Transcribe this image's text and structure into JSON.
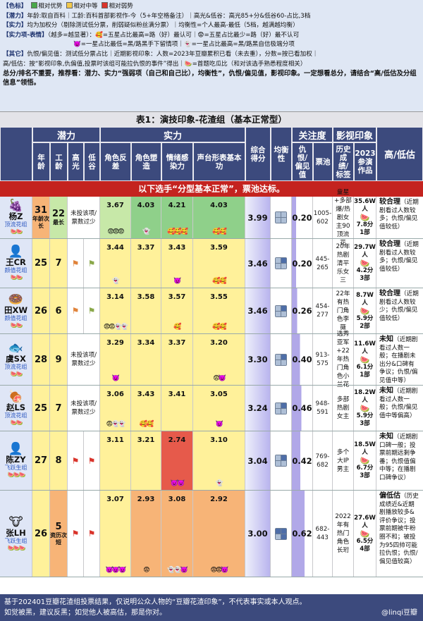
{
  "notes": {
    "line1": {
      "k": "【色标】",
      "good": "相对优势",
      "mid": "相对中等",
      "weak": "相对弱势",
      "c_good": "#4aa84a",
      "c_mid": "#f2c94c",
      "c_weak": "#d9342b"
    },
    "line2": {
      "k": "【潜力】",
      "t": "年龄:取自百科｜工龄:百科首部影视作-今（5+年空格备注）｜高光&低谷：高光85+分&低谷60-占比,3档"
    },
    "line3": {
      "k": "【实力】",
      "t": "均为加权分（剔除测试低分票，削弱疑似粉丝满分票）｜均衡性=个人最高-最低（5档，越满越均衡）"
    },
    "line4": {
      "k": "【实力项-表情】",
      "t": "（越多=越显著）：🥰=五星占比最高=路（好）最认可｜😨=五星占比最少=路（好）最不认可"
    },
    "line5": {
      "t": "👿=一星占比最低=黑/路黑手下留情项｜👻=一星占比最高=黑/路黑自信极端分项"
    },
    "line6": {
      "k": "【其它】",
      "t": "仇恨/偏见值：测试低分票占比｜近期影视印象：人数=2023年豆瓣累积已看（未去重），分数=按已看加权｜"
    },
    "line7": {
      "t": "高/低估：按“影视印象,仇偏值,投票时该组可能拉仇恨的事件”得出｜🍉=首题吃瓜比（和对该选手熟悉程度相关）"
    },
    "line8": {
      "t": "总分/排名不重要，推荐看：潜力、实力“强弱项（自己和自己比），均衡性”，仇恨/偏见值，影视印象。一定想看总分，请结合“高/低估及分组信息”领悟。"
    }
  },
  "table": {
    "title": "表1：演技印象-花渣组（基本正常型）",
    "groups": {
      "potential": "潜力",
      "strength": "实力",
      "attention": "关注度",
      "impression": "影视印象",
      "estimate": "高/低估"
    },
    "cols": {
      "age": "年龄",
      "work": "工龄",
      "high": "高光",
      "low": "低谷",
      "ab1": "角色反差",
      "ab2": "角色塑造",
      "ab3": "情绪感染力",
      "ab4": "声台形表基本功",
      "comp": "综合得分",
      "bal": "均衡性",
      "hate": "仇恨/偏见值",
      "box": "票池",
      "hist": "历史成绩/标签",
      "ref": "2023参演作品"
    },
    "banner": "以下选手“分型基本正常”，票池达标。",
    "rows": [
      {
        "avatar": "🍇",
        "name": "杨Z",
        "type": "顶流花组",
        "melon": "🍉🍉",
        "age": "31",
        "age_tag": "年龄次长",
        "work": "22",
        "work_tag": "最长",
        "hl_text": "未投该项/票数过少",
        "s": [
          "3.67",
          "4.03",
          "4.21",
          "4.03"
        ],
        "e": [
          "😨😨😨",
          "👻",
          "🥰🥰🥰",
          "🥰🥰"
        ],
        "comp": "3.99",
        "bal": [
          1,
          1,
          1,
          1
        ],
        "hate": "0.20",
        "box": "1005-602",
        "hist": "童星+多部爆/热剧女主90顶流花",
        "people": "35.6W人",
        "score": "7.8分",
        "parts": "1部",
        "est": "较合理",
        "est_text": "（近期剧看过人数较多；仇恨/偏见值较低）"
      },
      {
        "avatar": "👤",
        "name": "王CR",
        "type": "颜值花组",
        "melon": "🍉🍉",
        "age": "25",
        "age_tag": "",
        "work": "7",
        "work_tag": "",
        "hl_text": "",
        "s": [
          "3.44",
          "3.37",
          "3.43",
          "3.59"
        ],
        "e": [
          "👻",
          "",
          "👿",
          "🥰🥰"
        ],
        "comp": "3.46",
        "bal": [
          1,
          0,
          1,
          1
        ],
        "hate": "0.20",
        "box": "445-265",
        "hist": "20年热剧清平乐女三",
        "people": "29.7W人",
        "score": "4.2分",
        "parts": "3部",
        "est": "较合理",
        "est_text": "（近期剧看过人数较多；仇恨/偏见值较低）"
      },
      {
        "avatar": "🍩",
        "name": "田XW",
        "type": "颜值花组",
        "melon": "🍉🍉",
        "age": "26",
        "age_tag": "",
        "work": "6",
        "work_tag": "",
        "hl_text": "",
        "s": [
          "3.14",
          "3.58",
          "3.57",
          "3.55"
        ],
        "e": [
          "😨😨👻👻",
          "",
          "🥰",
          "🥰🥰"
        ],
        "comp": "3.46",
        "bal": [
          1,
          0,
          1,
          1
        ],
        "hate": "0.26",
        "box": "454-277",
        "hist": "22年有热门角色李薇",
        "people": "8.7W人",
        "score": "5.9分",
        "parts": "2部",
        "est": "较合理",
        "est_text": "（近期剧看过人数较少；仇恨/偏见值较低）"
      },
      {
        "avatar": "🐟",
        "name": "虞SX",
        "type": "顶流花组",
        "melon": "🍉🍉",
        "age": "28",
        "age_tag": "",
        "work": "9",
        "work_tag": "",
        "hl_text": "未投该项/票数过少",
        "s": [
          "3.29",
          "3.34",
          "3.37",
          "3.20"
        ],
        "e": [
          "👿",
          "",
          "",
          "😨👿"
        ],
        "comp": "3.30",
        "bal": [
          1,
          0,
          1,
          1
        ],
        "hate": "0.40",
        "box": "913-575",
        "hist": "选秀亚军+22年热门角色小兰花",
        "people": "11.6W人",
        "score": "6.1分",
        "parts": "1部",
        "est": "未知",
        "est_text": "（近期剧看过人数一般；在播剧未出分&口碑有争议；仇恨/偏见值中等）"
      },
      {
        "avatar": "🍖",
        "name": "赵LS",
        "type": "顶流花组",
        "melon": "🍉🍉",
        "age": "25",
        "age_tag": "",
        "work": "7",
        "work_tag": "",
        "hl_text": "未投该项/票数过少",
        "s": [
          "3.06",
          "3.43",
          "3.41",
          "3.05"
        ],
        "e": [
          "😨👻👻",
          "🥰🥰",
          "",
          "👿"
        ],
        "comp": "3.24",
        "bal": [
          1,
          0,
          1,
          1
        ],
        "hate": "0.46",
        "box": "948-591",
        "hist": "多部热剧女主",
        "people": "18.2W人",
        "score": "5.9分",
        "parts": "3部",
        "est": "未知",
        "est_text": "（近期剧看过人数一般；仇恨/偏见值中等偏高）"
      },
      {
        "avatar": "👤",
        "name": "陈ZY",
        "type": "飞跃生组",
        "melon": "🍉🍉🍉",
        "age": "27",
        "age_tag": "",
        "work": "8",
        "work_tag": "",
        "hl_text": "",
        "s": [
          "3.11",
          "3.21",
          "2.74",
          "3.10"
        ],
        "e": [
          "",
          "",
          "👿👿",
          "👻"
        ],
        "comp": "3.04",
        "bal": [
          1,
          0,
          1,
          1
        ],
        "hate": "0.42",
        "box": "769-682",
        "hist": "多个大IP男主",
        "people": "18.5W人",
        "score": "6.7分",
        "parts": "3部",
        "est": "未知",
        "est_text": "（近期剧口碑一般；投票前期远剩争番；仇恨值偏中等；在播剧口碑争议）"
      },
      {
        "avatar": "🐮",
        "name": "张LH",
        "type": "飞跃生组",
        "melon": "🍉🍉🍉",
        "age": "26",
        "age_tag": "",
        "work": "5",
        "work_tag": "资历次短",
        "hl_text": "",
        "s": [
          "3.07",
          "2.93",
          "3.08",
          "2.92"
        ],
        "e": [
          "👿👿👿",
          "😨",
          "👻👻👿",
          "😨😨👿"
        ],
        "comp": "3.00",
        "bal": [
          0,
          0,
          1,
          0
        ],
        "hate": "0.62",
        "box": "682-443",
        "hist": "2022年有热门角色长珩",
        "people": "27.6W人",
        "score": "6.5分",
        "parts": "4部",
        "est": "偏低估",
        "est_text": "（历史成绩近&近期剧播放较多&评价争议；投票前期被牛粉圈不和；被投为95四帅可能拉仇恨；仇恨/偏见值较高）"
      }
    ]
  },
  "footer": {
    "line1": "基于202401豆瓣花渣组投票结果，仅说明公众人物的“豆瓣花渣印象”，不代表事实或本人观点。",
    "line2": "如觉被黑，建议反黑；如觉他人被高估，那是你对。",
    "handle": "@linqi豆瓣"
  },
  "colors": {
    "green": "#8fd08a",
    "yellow": "#fff19a",
    "orange": "#f7b477",
    "red": "#e65a4b",
    "lightgreen": "#c7e8a8",
    "purple": "#b1a8e8"
  }
}
